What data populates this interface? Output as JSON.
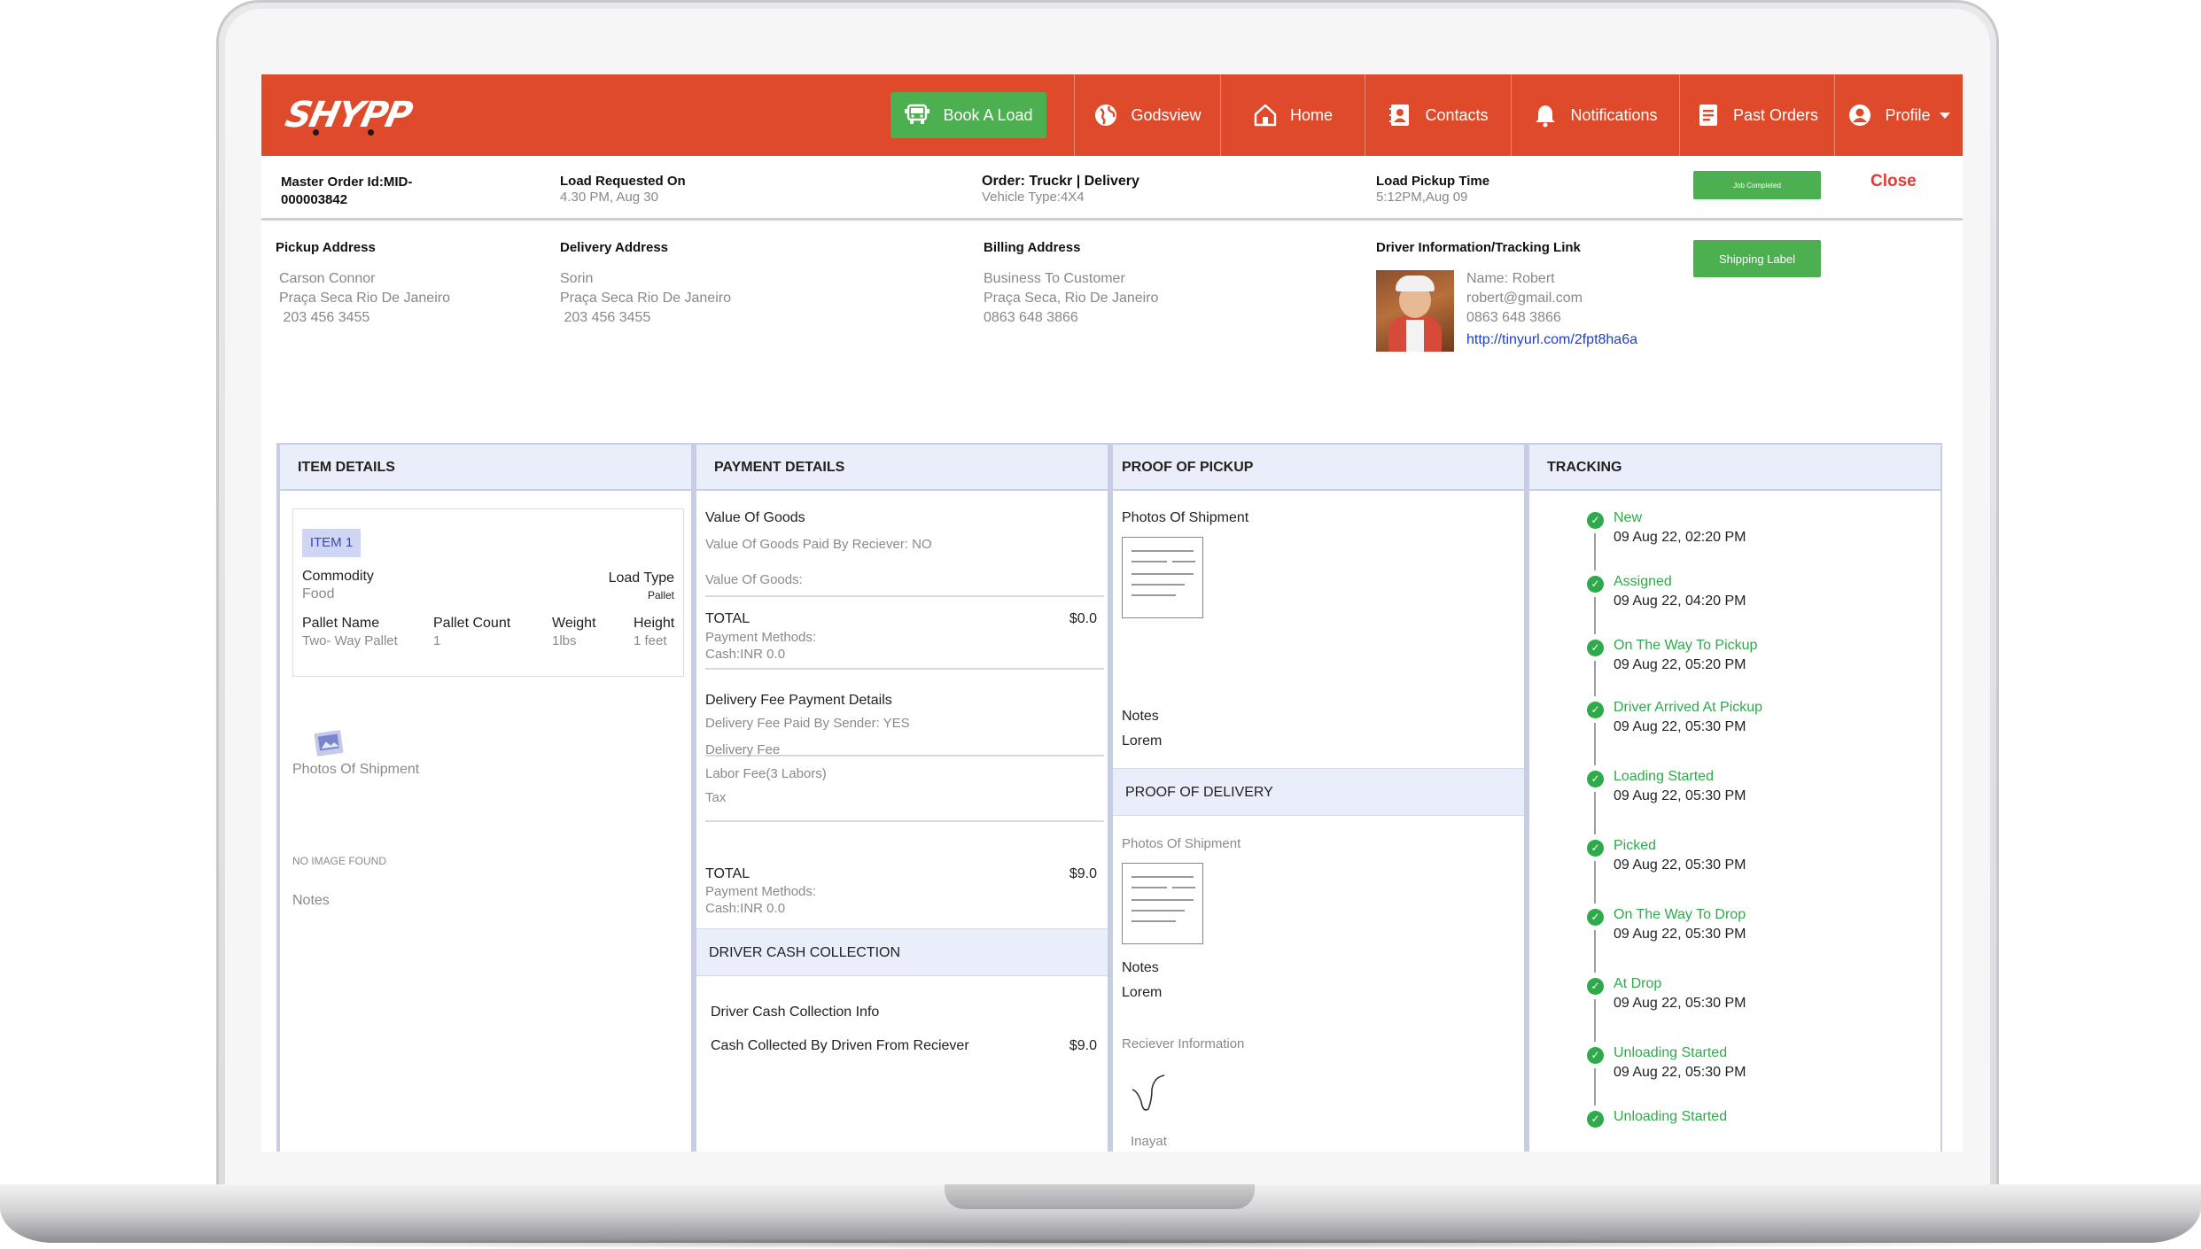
{
  "nav": {
    "logo": "SHYPP",
    "book_load": "Book A Load",
    "items": [
      {
        "label": "Godsview",
        "icon": "globe-icon"
      },
      {
        "label": "Home",
        "icon": "home-icon"
      },
      {
        "label": "Contacts",
        "icon": "contacts-icon"
      },
      {
        "label": "Notifications",
        "icon": "bell-icon"
      },
      {
        "label": "Past Orders",
        "icon": "document-icon"
      },
      {
        "label": "Profile",
        "icon": "user-icon"
      }
    ]
  },
  "order": {
    "master_id_label": "Master Order Id:MID-",
    "master_id_value": "000003842",
    "requested_label": "Load Requested On",
    "requested_value": "4.30 PM, Aug 30",
    "order_label": "Order: Truckr | Delivery",
    "vehicle_type": "Vehicle Type:4X4",
    "pickup_time_label": "Load Pickup Time",
    "pickup_time_value": "5:12PM,Aug 09",
    "job_button": "Job Completed",
    "close": "Close",
    "shipping_label_button": "Shipping Label"
  },
  "addresses": {
    "pickup": {
      "title": "Pickup Address",
      "name": "Carson Connor",
      "address": "Praça Seca Rio De Janeiro",
      "phone": " 203 456 3455"
    },
    "delivery": {
      "title": "Delivery Address",
      "name": "Sorin",
      "address": "Praça Seca Rio De Janeiro",
      "phone": " 203 456 3455"
    },
    "billing": {
      "title": "Billing Address",
      "name": "Business To Customer",
      "address": "Praça Seca, Rio De Janeiro",
      "phone": "0863 648 3866"
    },
    "driver": {
      "title": "Driver Information/Tracking Link",
      "name": "Name: Robert",
      "email": "robert@gmail.com",
      "phone": "0863 648 3866",
      "link": "http://tinyurl.com/2fpt8ha6a"
    }
  },
  "item_details": {
    "header": "ITEM  DETAILS",
    "badge": "ITEM 1",
    "commodity_label": "Commodity",
    "commodity_value": "Food",
    "load_type_label": "Load Type",
    "load_type_value": "Pallet",
    "pallet_name_label": "Pallet Name",
    "pallet_name_value": "Two- Way Pallet",
    "pallet_count_label": "Pallet Count",
    "pallet_count_value": "1",
    "weight_label": "Weight",
    "weight_value": "1lbs",
    "height_label": "Height",
    "height_value": "1 feet",
    "photos_label": "Photos Of Shipment",
    "no_image": "NO IMAGE FOUND",
    "notes_label": "Notes"
  },
  "payment": {
    "header": "PAYMENT DETAILS",
    "value_of_goods_title": "Value Of Goods",
    "value_paid_by_receiver": "Value Of Goods Paid By Reciever: NO",
    "value_of_goods_label": "Value Of Goods:",
    "total1_label": "TOTAL",
    "total1_value": "$0.0",
    "methods1_label": "Payment Methods:",
    "methods1_value": "Cash:INR 0.0",
    "delivery_fee_title": "Delivery Fee Payment Details",
    "delivery_paid_by_sender": "Delivery Fee Paid By Sender: YES",
    "delivery_fee": "Delivery Fee",
    "labor_fee": "Labor Fee(3 Labors)",
    "tax": "Tax",
    "total2_label": "TOTAL",
    "total2_value": "$9.0",
    "methods2_label": "Payment Methods:",
    "methods2_value": "Cash:INR 0.0",
    "driver_cash_header": "DRIVER CASH COLLECTION",
    "driver_cash_info": "Driver Cash Collection Info",
    "cash_collected_label": "Cash Collected By Driven From Reciever",
    "cash_collected_value": "$9.0"
  },
  "proof": {
    "pickup_header": "PROOF OF PICKUP",
    "pickup_photos": "Photos Of Shipment",
    "pickup_notes_label": "Notes",
    "pickup_notes_value": "Lorem",
    "delivery_header": "PROOF OF DELIVERY",
    "delivery_photos": "Photos Of Shipment",
    "delivery_notes_label": "Notes",
    "delivery_notes_value": "Lorem",
    "receiver_info": "Reciever Information",
    "receiver_name": "Inayat"
  },
  "tracking": {
    "header": "TRACKING",
    "events": [
      {
        "status": "New",
        "time": "09 Aug 22, 02:20 PM"
      },
      {
        "status": "Assigned",
        "time": "09 Aug 22, 04:20 PM"
      },
      {
        "status": "On The Way To Pickup",
        "time": "09 Aug 22, 05:20 PM"
      },
      {
        "status": "Driver Arrived At Pickup",
        "time": "09 Aug 22, 05:30 PM"
      },
      {
        "status": "Loading Started",
        "time": "09 Aug 22, 05:30 PM"
      },
      {
        "status": "Picked",
        "time": "09 Aug 22, 05:30 PM"
      },
      {
        "status": "On The Way To Drop",
        "time": "09 Aug 22, 05:30 PM"
      },
      {
        "status": "At Drop",
        "time": "09 Aug 22, 05:30 PM"
      },
      {
        "status": "Unloading Started",
        "time": "09 Aug 22, 05:30 PM"
      },
      {
        "status": "Unloading Started",
        "time": ""
      }
    ]
  },
  "colors": {
    "brand": "#df4a2a",
    "success": "#4caf50",
    "track": "#2eaa4a",
    "close": "#e53935"
  }
}
